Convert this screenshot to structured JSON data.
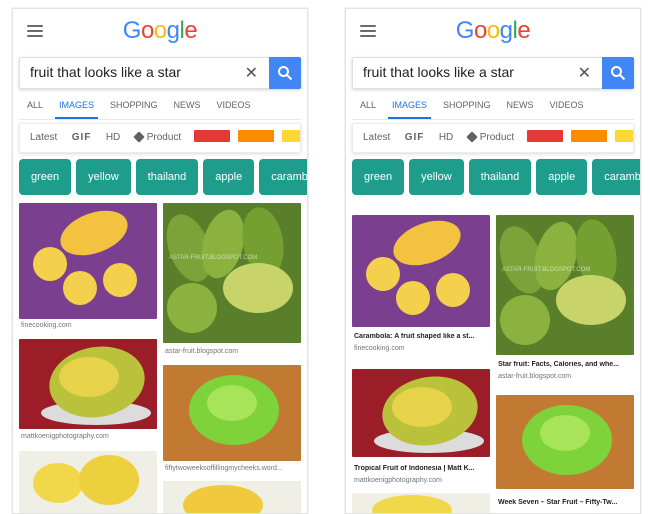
{
  "search": {
    "logo": [
      "G",
      "o",
      "o",
      "g",
      "l",
      "e"
    ],
    "query": "fruit that looks like a star"
  },
  "tabs": [
    "ALL",
    "IMAGES",
    "SHOPPING",
    "NEWS",
    "VIDEOS"
  ],
  "filters": {
    "latest": "Latest",
    "gif": "GIF",
    "hd": "HD",
    "product": "Product"
  },
  "colors": {
    "google_blue": "#4285f4",
    "google_red": "#ea4335",
    "google_yellow": "#fbbc05",
    "google_green": "#34a853",
    "chip": "#1f9d8c",
    "swatch_red": "#e53935",
    "swatch_orange": "#fb8c00",
    "swatch_yellow": "#fdd835"
  },
  "chips": [
    "green",
    "yellow",
    "thailand",
    "apple",
    "carambola"
  ],
  "left_results": [
    {
      "source": "finecooking.com"
    },
    {
      "source": "astar-fruit.blogspot.com"
    },
    {
      "source": "mattkoenigphotography.com"
    },
    {
      "source": "fiftytwoweeksoffillingmycheeks.word..."
    }
  ],
  "right_results": [
    {
      "title": "Carambola: A fruit shaped like a st...",
      "source": "finecooking.com"
    },
    {
      "title": "Star fruit: Facts, Calories, and whe...",
      "source": "astar-fruit.blogspot.com"
    },
    {
      "title": "Tropical Fruit of Indonesia | Matt K...",
      "source": "mattkoenigphotography.com"
    },
    {
      "title": "Week Seven – Star Fruit – Fifty-Tw...",
      "source": ""
    }
  ],
  "watermark": "ASTAR-FRUIT.BLOGSPOT.COM"
}
